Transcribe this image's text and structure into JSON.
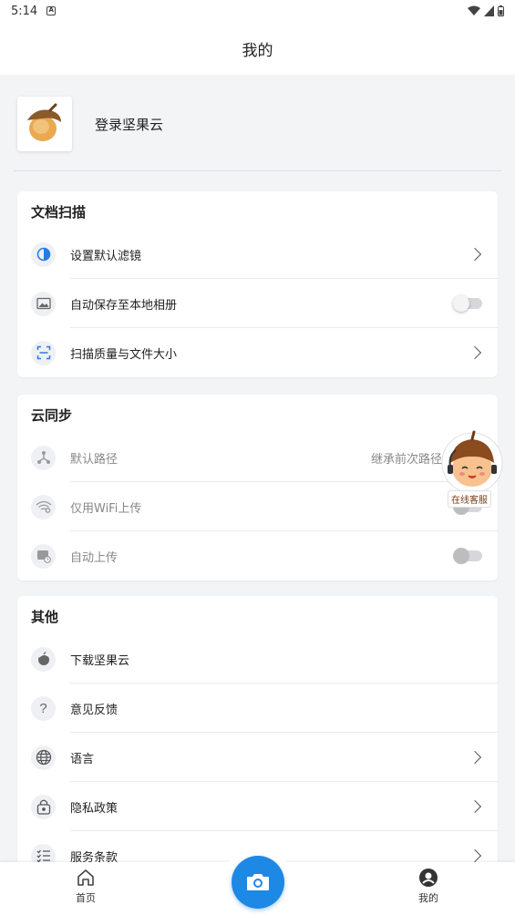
{
  "status_bar": {
    "time": "5:14"
  },
  "header": {
    "title": "我的"
  },
  "account": {
    "login_label": "登录坚果云"
  },
  "doc_scan": {
    "title": "文档扫描",
    "items": [
      {
        "label": "设置默认滤镜",
        "icon": "contrast-icon"
      },
      {
        "label": "自动保存至本地相册",
        "icon": "image-icon",
        "toggle": false
      },
      {
        "label": "扫描质量与文件大小",
        "icon": "scan-frame-icon"
      }
    ]
  },
  "cloud_sync": {
    "title": "云同步",
    "items": [
      {
        "label": "默认路径",
        "value": "继承前次路径",
        "icon": "fork-icon"
      },
      {
        "label": "仅用WiFi上传",
        "icon": "wifi-icon",
        "toggle": false
      },
      {
        "label": "自动上传",
        "icon": "auto-upload-icon",
        "toggle": false
      }
    ]
  },
  "other": {
    "title": "其他",
    "items": [
      {
        "label": "下载坚果云",
        "icon": "nut-icon"
      },
      {
        "label": "意见反馈",
        "icon": "question-icon"
      },
      {
        "label": "语言",
        "icon": "globe-icon"
      },
      {
        "label": "隐私政策",
        "icon": "lock-icon"
      },
      {
        "label": "服务条款",
        "icon": "list-icon"
      }
    ]
  },
  "customer_service": {
    "label": "在线客服"
  },
  "bottom_nav": {
    "home_label": "首页",
    "mine_label": "我的"
  },
  "colors": {
    "accent": "#1e88e5",
    "contrast_icon": "#2a7be4"
  }
}
